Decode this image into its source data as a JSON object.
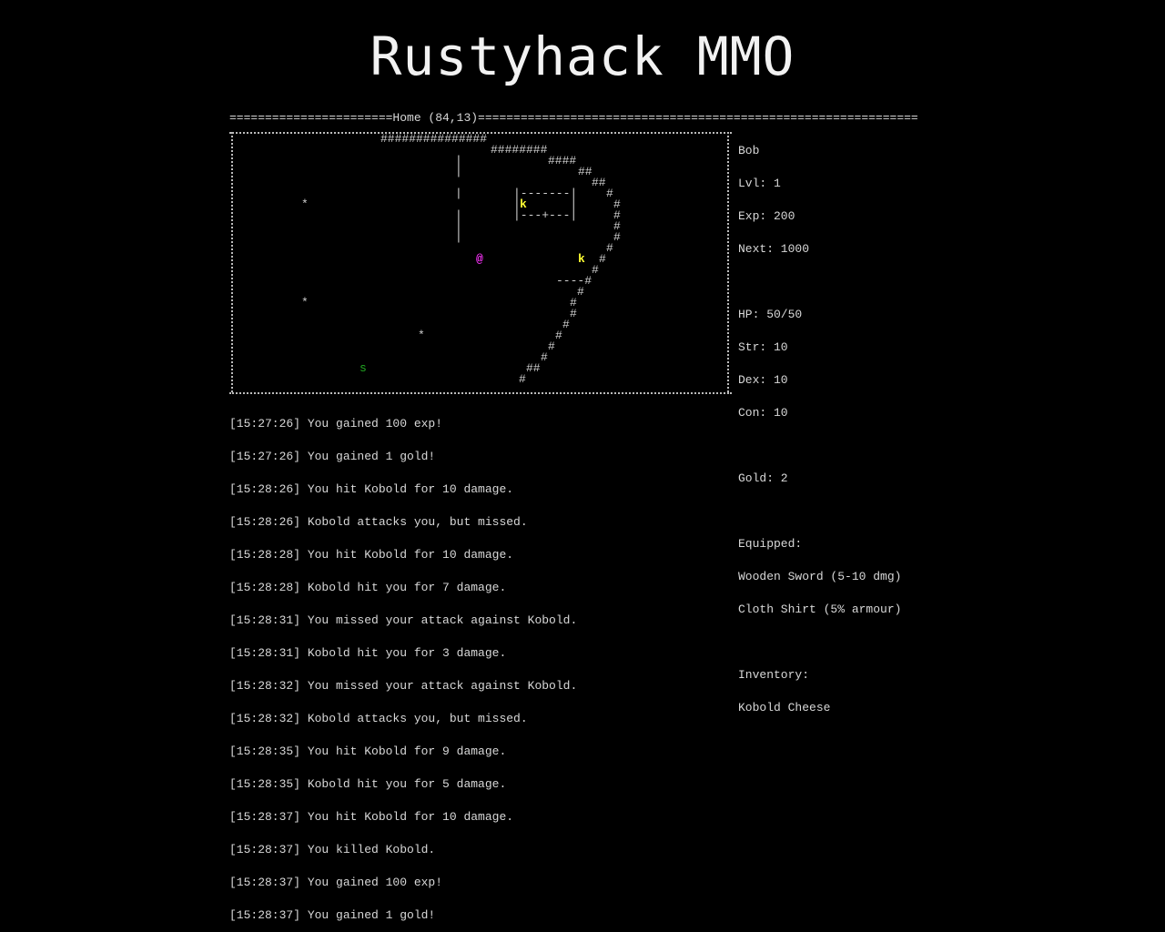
{
  "game": {
    "title": "Rustyhack MMO"
  },
  "map": {
    "header": "=======================Home (84,13)==============================================================",
    "player_glyph": "@",
    "kobold_glyph": "k",
    "snake_glyph": "s",
    "item_glyph": "*"
  },
  "stats": {
    "name": "Bob",
    "level": "Lvl: 1",
    "exp": "Exp: 200",
    "next": "Next: 1000",
    "hp": "HP: 50/50",
    "str": "Str: 10",
    "dex": "Dex: 10",
    "con": "Con: 10",
    "gold": "Gold: 2",
    "equipped_label": "Equipped:",
    "equipped": [
      "Wooden Sword (5-10 dmg)",
      "Cloth Shirt (5% armour)"
    ],
    "inventory_label": "Inventory:",
    "inventory": [
      "Kobold Cheese"
    ]
  },
  "log": [
    "[15:27:26] You gained 100 exp!",
    "[15:27:26] You gained 1 gold!",
    "[15:28:26] You hit Kobold for 10 damage.",
    "[15:28:26] Kobold attacks you, but missed.",
    "[15:28:28] You hit Kobold for 10 damage.",
    "[15:28:28] Kobold hit you for 7 damage.",
    "[15:28:31] You missed your attack against Kobold.",
    "[15:28:31] Kobold hit you for 3 damage.",
    "[15:28:32] You missed your attack against Kobold.",
    "[15:28:32] Kobold attacks you, but missed.",
    "[15:28:35] You hit Kobold for 9 damage.",
    "[15:28:35] Kobold hit you for 5 damage.",
    "[15:28:37] You hit Kobold for 10 damage.",
    "[15:28:37] You killed Kobold.",
    "[15:28:37] You gained 100 exp!",
    "[15:28:37] You gained 1 gold!"
  ]
}
